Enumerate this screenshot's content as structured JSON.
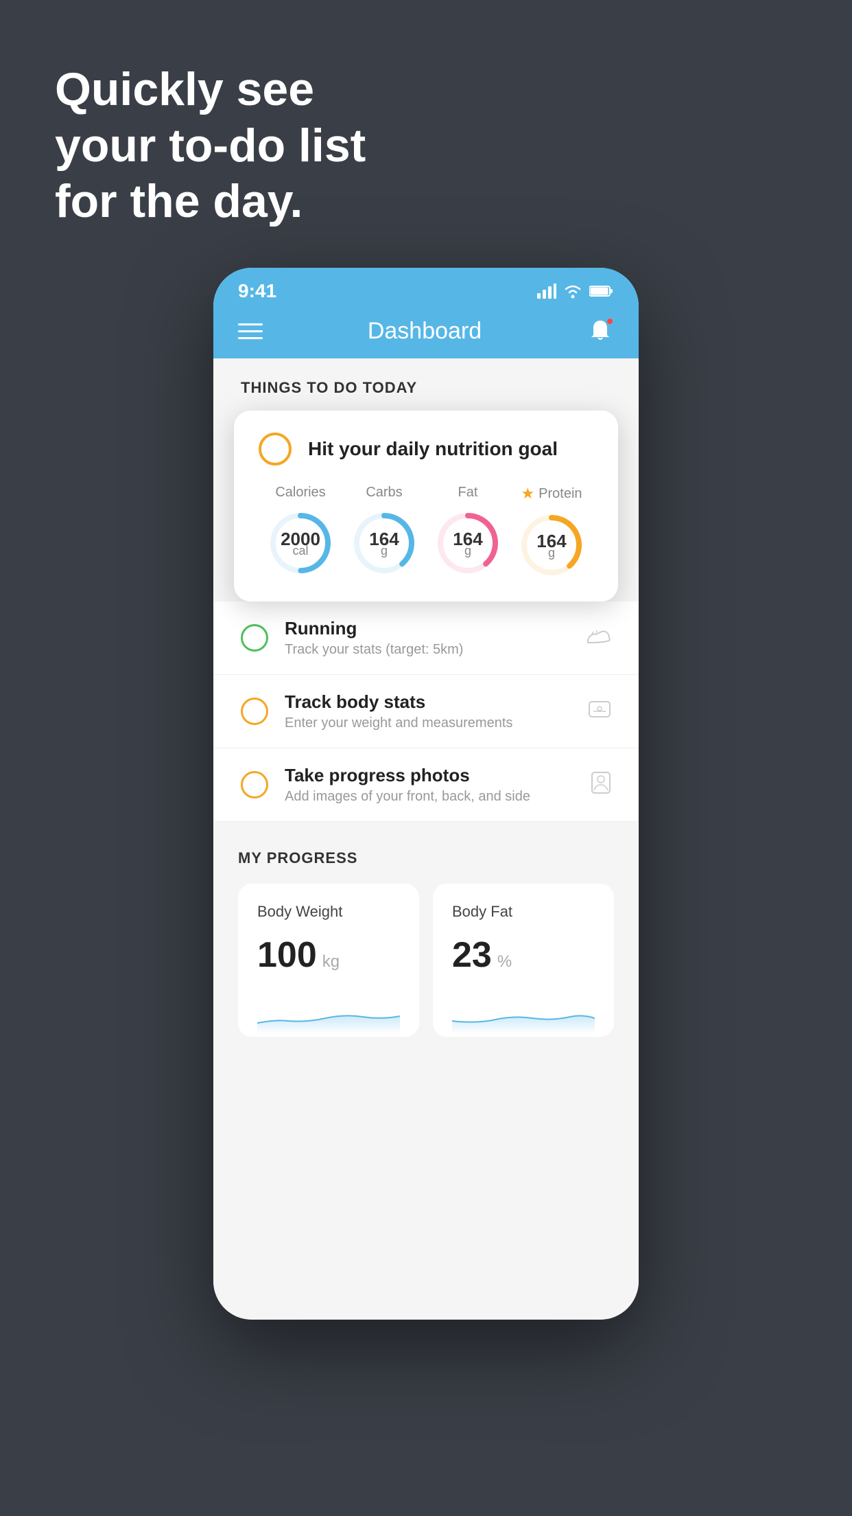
{
  "hero": {
    "line1": "Quickly see",
    "line2": "your to-do list",
    "line3": "for the day."
  },
  "statusBar": {
    "time": "9:41",
    "signalLabel": "signal",
    "wifiLabel": "wifi",
    "batteryLabel": "battery"
  },
  "navbar": {
    "title": "Dashboard",
    "menuLabel": "menu",
    "bellLabel": "notifications"
  },
  "thingsToday": {
    "sectionTitle": "THINGS TO DO TODAY"
  },
  "nutritionCard": {
    "title": "Hit your daily nutrition goal",
    "calories": {
      "label": "Calories",
      "value": "2000",
      "unit": "cal",
      "color": "#56b7e6"
    },
    "carbs": {
      "label": "Carbs",
      "value": "164",
      "unit": "g",
      "color": "#56b7e6"
    },
    "fat": {
      "label": "Fat",
      "value": "164",
      "unit": "g",
      "color": "#f06292"
    },
    "protein": {
      "label": "Protein",
      "value": "164",
      "unit": "g",
      "color": "#f5a623",
      "starred": true
    }
  },
  "todoItems": [
    {
      "title": "Running",
      "subtitle": "Track your stats (target: 5km)",
      "circleColor": "green",
      "icon": "shoe"
    },
    {
      "title": "Track body stats",
      "subtitle": "Enter your weight and measurements",
      "circleColor": "yellow",
      "icon": "scale"
    },
    {
      "title": "Take progress photos",
      "subtitle": "Add images of your front, back, and side",
      "circleColor": "yellow",
      "icon": "portrait"
    }
  ],
  "progress": {
    "sectionTitle": "MY PROGRESS",
    "bodyWeight": {
      "label": "Body Weight",
      "value": "100",
      "unit": "kg"
    },
    "bodyFat": {
      "label": "Body Fat",
      "value": "23",
      "unit": "%"
    }
  }
}
